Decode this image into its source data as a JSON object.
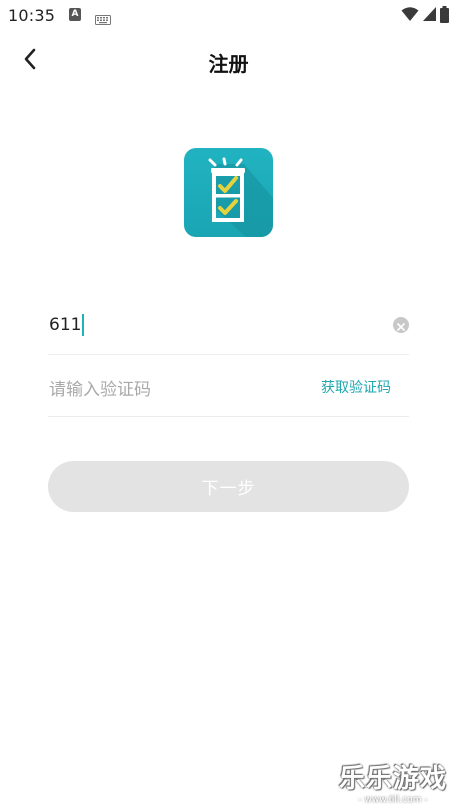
{
  "status_bar": {
    "time": "10:35",
    "a_icon_letter": "A"
  },
  "header": {
    "title": "注册"
  },
  "form": {
    "phone_value": "611",
    "code_placeholder": "请输入验证码",
    "get_code_label": "获取验证码",
    "next_label": "下一步"
  },
  "colors": {
    "accent": "#1fa7b0",
    "logo_bg": "#1fadbb",
    "button_disabled": "#e3e3e3"
  },
  "watermark": {
    "title": "乐乐游戏",
    "url": "- www.6ll.com -"
  }
}
